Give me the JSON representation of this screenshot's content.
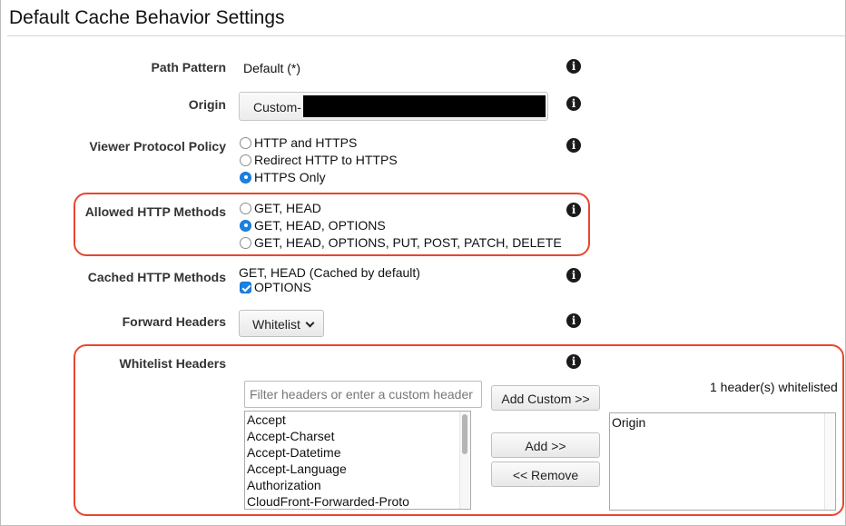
{
  "title": "Default Cache Behavior Settings",
  "path_pattern": {
    "label": "Path Pattern",
    "value": "Default (*)"
  },
  "origin": {
    "label": "Origin",
    "value": "Custom-"
  },
  "viewer_protocol": {
    "label": "Viewer Protocol Policy",
    "options": [
      "HTTP and HTTPS",
      "Redirect HTTP to HTTPS",
      "HTTPS Only"
    ],
    "selected": "HTTPS Only"
  },
  "allowed_methods": {
    "label": "Allowed HTTP Methods",
    "options": [
      "GET, HEAD",
      "GET, HEAD, OPTIONS",
      "GET, HEAD, OPTIONS, PUT, POST, PATCH, DELETE"
    ],
    "selected": "GET, HEAD, OPTIONS"
  },
  "cached_methods": {
    "label": "Cached HTTP Methods",
    "default_text": "GET, HEAD (Cached by default)",
    "options_checkbox": "OPTIONS",
    "options_checked": true
  },
  "forward_headers": {
    "label": "Forward Headers",
    "value": "Whitelist"
  },
  "whitelist": {
    "label": "Whitelist Headers",
    "filter_placeholder": "Filter headers or enter a custom header",
    "add_custom": "Add Custom >>",
    "add": "Add >>",
    "remove": "<< Remove",
    "count_text": "1 header(s) whitelisted",
    "available": [
      "Accept",
      "Accept-Charset",
      "Accept-Datetime",
      "Accept-Language",
      "Authorization",
      "CloudFront-Forwarded-Proto"
    ],
    "selected_headers": [
      "Origin"
    ]
  },
  "info_glyph": "i",
  "icons": {
    "info": "info-icon",
    "dropdown": "chevron-down-icon"
  },
  "colors": {
    "accent": "#1a82e6",
    "highlight": "#e8462e"
  }
}
